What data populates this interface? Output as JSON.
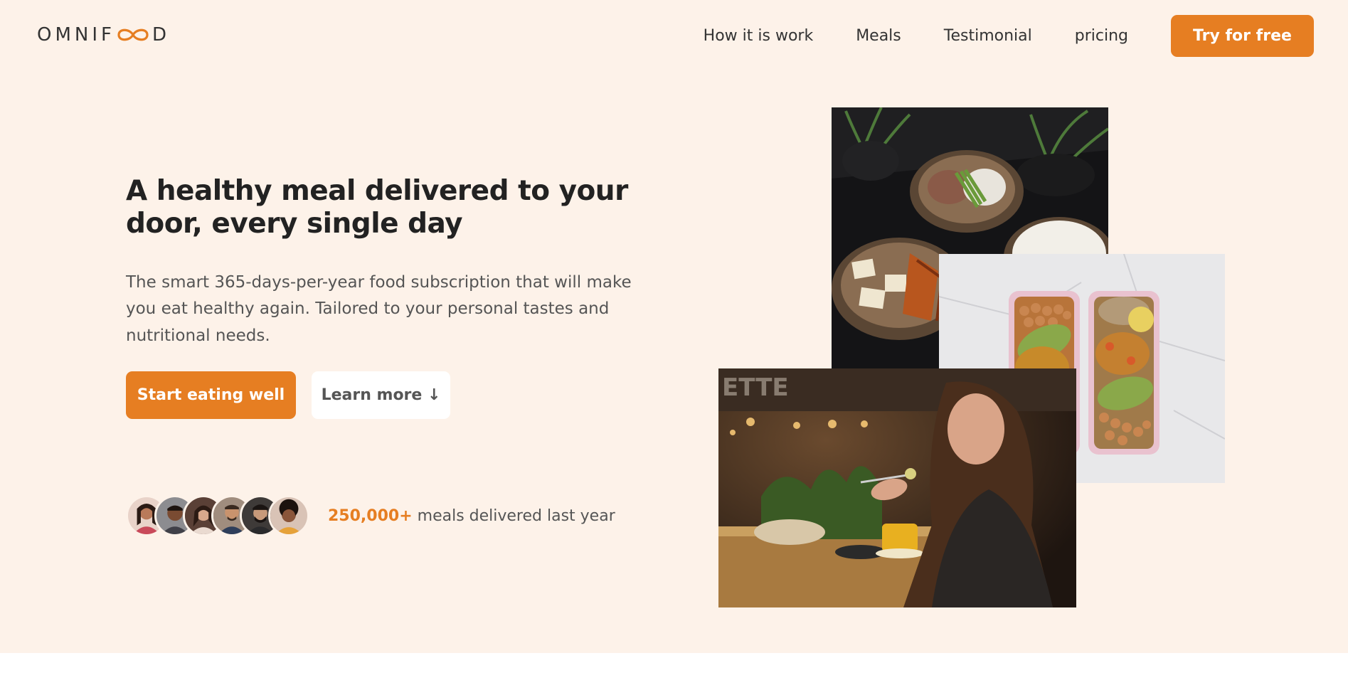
{
  "header": {
    "logo_text_left": "OMNIF",
    "logo_text_right": "D",
    "nav": [
      {
        "label": "How it is work"
      },
      {
        "label": "Meals"
      },
      {
        "label": "Testimonial"
      },
      {
        "label": "pricing"
      }
    ],
    "cta_label": "Try for free"
  },
  "hero": {
    "title": "A healthy meal delivered to your door, every single day",
    "description": "The smart 365-days-per-year food subscription that will make you eat healthy again. Tailored to your personal tastes and nutritional needs.",
    "primary_button": "Start eating well",
    "secondary_button": "Learn more ↓",
    "delivered_count": "250,000+",
    "delivered_text": " meals delivered last year"
  },
  "colors": {
    "brand": "#e67e22",
    "hero_bg": "#fdf2e9"
  },
  "icons": {
    "logo_mark": "infinity-icon",
    "avatars": [
      "customer-avatar",
      "customer-avatar",
      "customer-avatar",
      "customer-avatar",
      "customer-avatar",
      "customer-avatar"
    ]
  }
}
